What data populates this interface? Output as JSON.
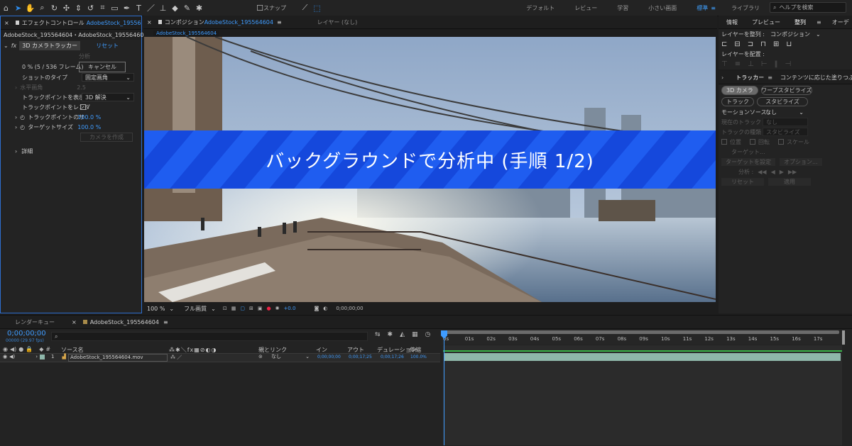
{
  "toolbar": {
    "snapping_label": "スナップ",
    "workspaces": [
      "デフォルト",
      "レビュー",
      "学習",
      "小さい画面",
      "標準",
      "ライブラリ"
    ],
    "active_workspace": "標準",
    "search_placeholder": "ヘルプを検索"
  },
  "effect_panel": {
    "tab_label": "エフェクトコントロール",
    "tab_file": "AdobeStock_195564604",
    "header": "AdobeStock_195564604・AdobeStock_195564604.mov",
    "effect_name": "3D カメラトラッカー",
    "reset_label": "リセット",
    "analyze_label": "分析",
    "progress_text": "0 % (5 / 536 フレーム)",
    "cancel_label": "キャンセル",
    "shot_type_label": "ショットのタイプ",
    "shot_type_value": "固定画角",
    "fov_label": "水平画角",
    "fov_value": "2.5",
    "show_points_label": "トラックポイントを表示",
    "show_points_value": "3D 解決",
    "render_points_label": "トラックポイントをレンダ",
    "point_size_label": "トラックポイントのサ",
    "point_size_value": "100.0 %",
    "target_size_label": "ターゲットサイズ",
    "target_size_value": "100.0 %",
    "create_camera_label": "カメラを作成",
    "advanced_label": "詳細"
  },
  "composition": {
    "tab_label": "コンポジション",
    "tab_file": "AdobeStock_195564604",
    "layer_tab": "レイヤー (なし)",
    "sub_tab": "AdobeStock_195564604",
    "banner_text": "バックグラウンドで分析中 (手順 1/2)",
    "zoom": "100 %",
    "resolution": "フル画質",
    "exposure": "+0.0",
    "timecode": "0;00;00;00"
  },
  "right_panel": {
    "tabs": [
      "情報",
      "プレビュー",
      "整列",
      "オーデ"
    ],
    "align_to_label": "レイヤーを整列 :",
    "align_to_value": "コンポジション",
    "distribute_label": "レイヤーを配置 :",
    "tracker_tab": "トラッカー",
    "content_fill_tab": "コンテンツに応じた塗りつぶし",
    "btn_camera": "3D カメラ",
    "btn_warp": "ワープスタビライズ",
    "btn_track": "トラック",
    "btn_stabilize": "スタビライズ",
    "motion_source_label": "モーションソース :",
    "motion_source_value": "なし",
    "current_track_label": "現在のトラック :",
    "current_track_value": "なし",
    "track_type_label": "トラックの種類 :",
    "track_type_value": "スタビライズ",
    "position_label": "位置",
    "rotation_label": "回転",
    "scale_label": "スケール",
    "target_label": "ターゲット...",
    "set_target_label": "ターゲットを設定",
    "options_label": "オプション...",
    "analyze_label": "分析 :",
    "reset_label": "リセット",
    "apply_label": "適用"
  },
  "timeline": {
    "render_queue_tab": "レンダーキュー",
    "comp_tab": "AdobeStock_195564604",
    "timecode": "0;00;00;00",
    "frame_info": "00000 (29.97 fps)",
    "columns": {
      "source_name": "ソース名",
      "parent": "親とリンク",
      "in": "イン",
      "out": "アウト",
      "duration": "デュレーション",
      "stretch": "伸縮"
    },
    "ruler": [
      "0s",
      "01s",
      "02s",
      "03s",
      "04s",
      "05s",
      "06s",
      "07s",
      "08s",
      "09s",
      "10s",
      "11s",
      "12s",
      "13s",
      "14s",
      "15s",
      "16s",
      "17s"
    ],
    "layer": {
      "index": "1",
      "name": "AdobeStock_195564604.mov",
      "parent": "なし",
      "in": "0;00;00;00",
      "out": "0;00;17;25",
      "duration": "0;00;17;26",
      "stretch": "100.0%"
    }
  },
  "colors": {
    "accent_blue": "#2d8ceb",
    "banner_blue": "#1a55e8",
    "layer_bar": "#8fb7ab"
  }
}
